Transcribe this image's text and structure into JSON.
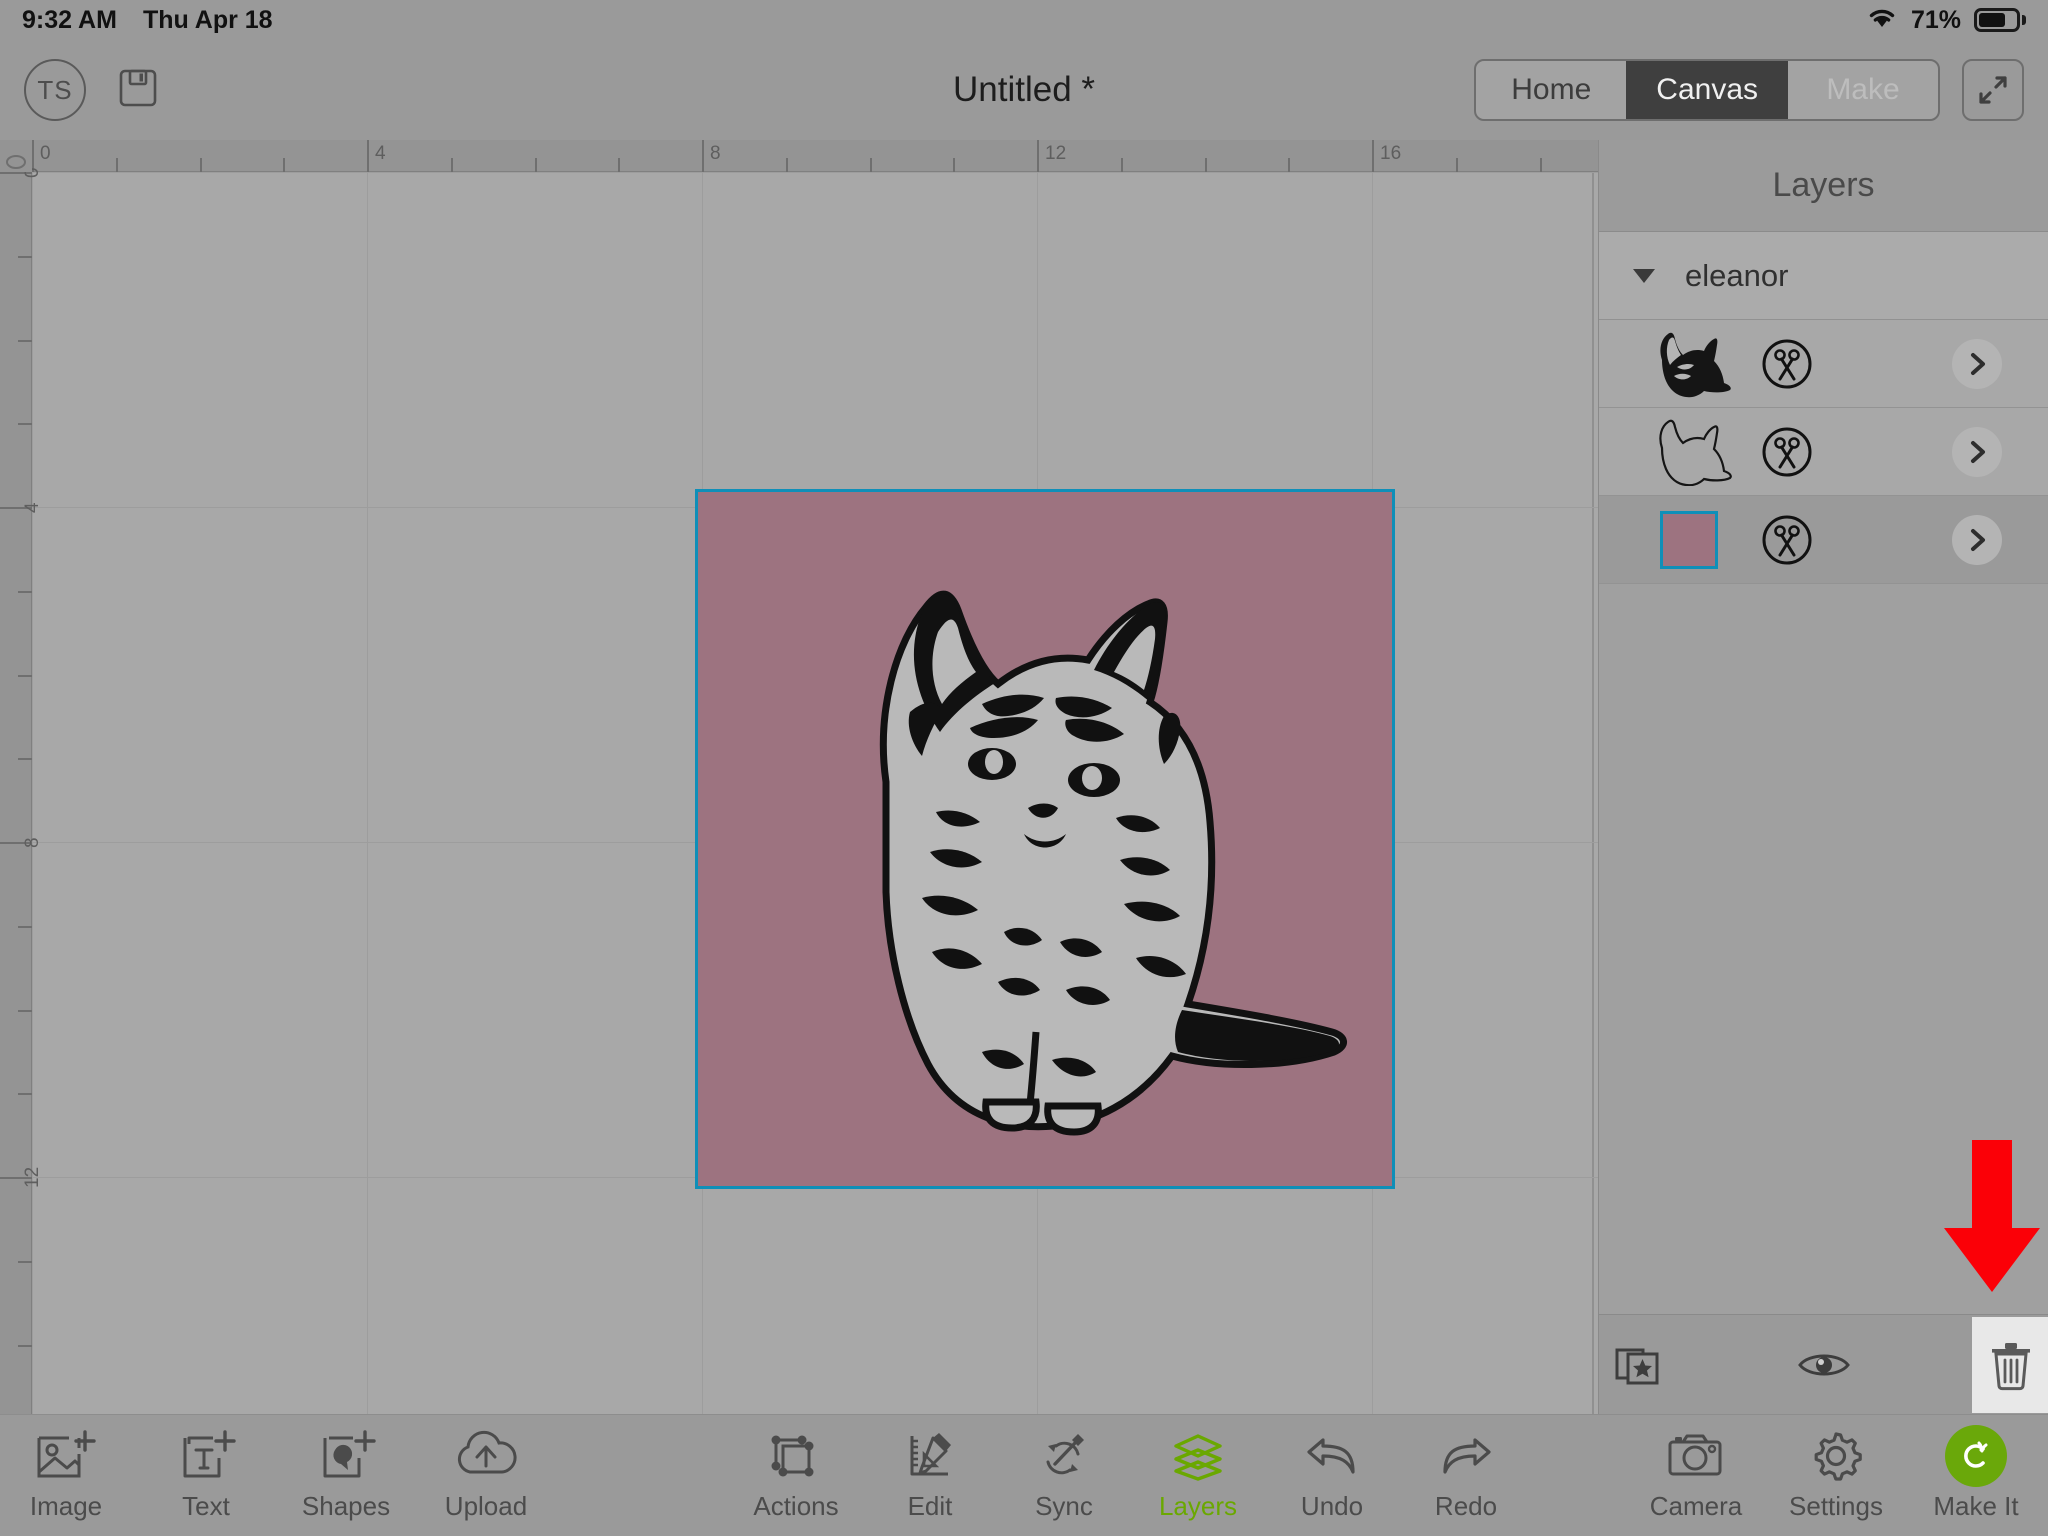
{
  "status_bar": {
    "time": "9:32 AM",
    "date": "Thu Apr 18",
    "battery_percent": "71%",
    "wifi_icon": "wifi-icon",
    "battery_icon": "battery-icon",
    "battery_level": 0.71
  },
  "top_bar": {
    "avatar_initials": "TS",
    "avatar_icon": "avatar",
    "save_icon": "floppy-disk-save-icon",
    "document_title": "Untitled *",
    "expand_icon": "expand-fullscreen-icon",
    "segments": [
      {
        "label": "Home",
        "state": "inactive"
      },
      {
        "label": "Canvas",
        "state": "active"
      },
      {
        "label": "Make",
        "state": "disabled"
      }
    ]
  },
  "canvas": {
    "ruler_h_labels": [
      "0",
      "4",
      "8",
      "12",
      "16"
    ],
    "ruler_v_labels": [
      "0",
      "4",
      "8",
      "12"
    ],
    "selection_color": "#0f8fb8",
    "background_color": "#a8a8a8",
    "object": {
      "name": "eleanor",
      "fill_color": "#9d7380",
      "selected": true,
      "artwork_icon": "cat-stencil-artwork"
    }
  },
  "layers_panel": {
    "title": "Layers",
    "group": {
      "name": "eleanor",
      "expanded": true,
      "caret_icon": "triangle-down-icon"
    },
    "rows": [
      {
        "thumb_icon": "cat-silhouette-thumbnail",
        "op_icon": "scissors-cut-icon",
        "chevron_icon": "chevron-right-icon",
        "selected": false
      },
      {
        "thumb_icon": "cat-outline-thumbnail",
        "op_icon": "scissors-cut-icon",
        "chevron_icon": "chevron-right-icon",
        "selected": false
      },
      {
        "thumb_icon": "color-swatch-thumbnail",
        "swatch_color": "#9d7380",
        "op_icon": "scissors-cut-icon",
        "chevron_icon": "chevron-right-icon",
        "selected": true
      }
    ],
    "footer_buttons": [
      {
        "icon": "duplicate-star-icon",
        "highlighted": false
      },
      {
        "icon": "eye-visibility-icon",
        "highlighted": false
      },
      {
        "icon": "trash-delete-icon",
        "highlighted": true
      }
    ]
  },
  "bottom_toolbar": {
    "left": [
      {
        "label": "Image",
        "icon": "add-image-icon"
      },
      {
        "label": "Text",
        "icon": "add-text-icon"
      },
      {
        "label": "Shapes",
        "icon": "add-shapes-icon"
      },
      {
        "label": "Upload",
        "icon": "cloud-upload-icon"
      }
    ],
    "center": [
      {
        "label": "Actions",
        "icon": "actions-transform-icon",
        "active": false
      },
      {
        "label": "Edit",
        "icon": "edit-ruler-pencil-icon",
        "active": false
      },
      {
        "label": "Sync",
        "icon": "sync-color-icon",
        "active": false
      },
      {
        "label": "Layers",
        "icon": "layers-stack-icon",
        "active": true
      },
      {
        "label": "Undo",
        "icon": "undo-arrow-icon",
        "active": false
      },
      {
        "label": "Redo",
        "icon": "redo-arrow-icon",
        "active": false
      }
    ],
    "right": [
      {
        "label": "Camera",
        "icon": "camera-icon"
      },
      {
        "label": "Settings",
        "icon": "gear-settings-icon"
      },
      {
        "label": "Make It",
        "icon": "cricut-logo-icon"
      }
    ],
    "active_color": "#6aa800"
  },
  "annotation": {
    "arrow_icon": "red-down-arrow-annotation",
    "arrow_color": "#fb0007",
    "points_at": "trash-delete-icon"
  }
}
